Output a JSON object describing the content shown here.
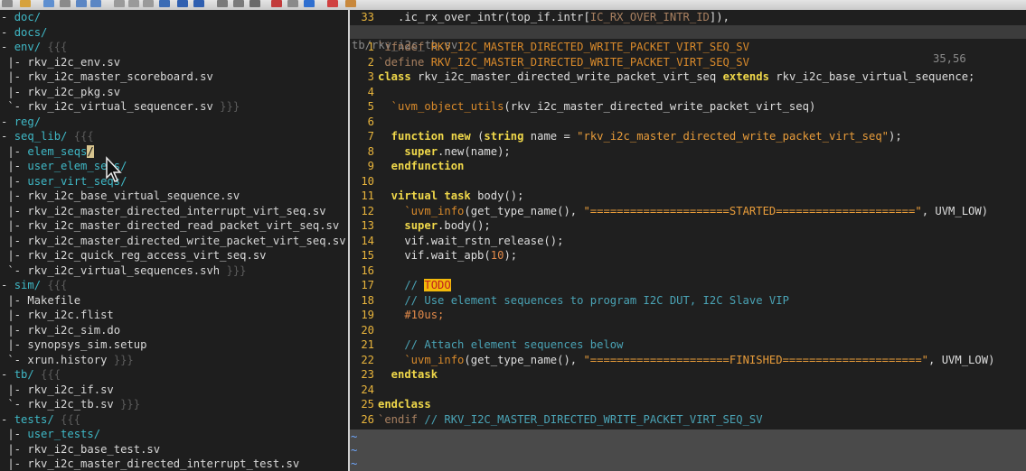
{
  "toolbar": {
    "icons": [
      "new-file-icon",
      "open-icon",
      "save-icon",
      "print-icon",
      "undo-icon",
      "redo-icon",
      "cut-icon",
      "copy-icon",
      "paste-icon",
      "find-icon",
      "back-icon",
      "forward-icon",
      "load-session-icon",
      "save-session-icon",
      "run-icon",
      "make-icon",
      "shell-icon",
      "tag-icon",
      "help-icon",
      "script-icon"
    ]
  },
  "file_tree": [
    {
      "text": "- doc/",
      "kind": "dir"
    },
    {
      "text": "- docs/",
      "kind": "dir"
    },
    {
      "text": "- env/",
      "kind": "dir",
      "fold": " {{{"
    },
    {
      "text": " |- rkv_i2c_env.sv",
      "kind": "file"
    },
    {
      "text": " |- rkv_i2c_master_scoreboard.sv",
      "kind": "file"
    },
    {
      "text": " |- rkv_i2c_pkg.sv",
      "kind": "file"
    },
    {
      "text": " `- rkv_i2c_virtual_sequencer.sv",
      "kind": "file",
      "fold": " }}}"
    },
    {
      "text": "- reg/",
      "kind": "dir"
    },
    {
      "text": "- seq_lib/",
      "kind": "dir",
      "fold": " {{{"
    },
    {
      "text": " |- elem_seqs",
      "kind": "dir",
      "sel": "/"
    },
    {
      "text": " |- user_elem_seqs/",
      "kind": "dir"
    },
    {
      "text": " |- user_virt_seqs/",
      "kind": "dir"
    },
    {
      "text": " |- rkv_i2c_base_virtual_sequence.sv",
      "kind": "file"
    },
    {
      "text": " |- rkv_i2c_master_directed_interrupt_virt_seq.sv",
      "kind": "file"
    },
    {
      "text": " |- rkv_i2c_master_directed_read_packet_virt_seq.sv",
      "kind": "file"
    },
    {
      "text": " |- rkv_i2c_master_directed_write_packet_virt_seq.sv",
      "kind": "file"
    },
    {
      "text": " |- rkv_i2c_quick_reg_access_virt_seq.sv",
      "kind": "file"
    },
    {
      "text": " `- rkv_i2c_virtual_sequences.svh",
      "kind": "file",
      "fold": " }}}"
    },
    {
      "text": "- sim/",
      "kind": "dir",
      "fold": " {{{"
    },
    {
      "text": " |- Makefile",
      "kind": "file"
    },
    {
      "text": " |- rkv_i2c.flist",
      "kind": "file"
    },
    {
      "text": " |- rkv_i2c_sim.do",
      "kind": "file"
    },
    {
      "text": " |- synopsys_sim.setup",
      "kind": "file"
    },
    {
      "text": " `- xrun.history",
      "kind": "file",
      "fold": " }}}"
    },
    {
      "text": "- tb/",
      "kind": "dir",
      "fold": " {{{"
    },
    {
      "text": " |- rkv_i2c_if.sv",
      "kind": "file"
    },
    {
      "text": " `- rkv_i2c_tb.sv",
      "kind": "file",
      "fold": " }}}"
    },
    {
      "text": "- tests/",
      "kind": "dir",
      "fold": " {{{"
    },
    {
      "text": " |- user_tests/",
      "kind": "dir"
    },
    {
      "text": " |- rkv_i2c_base_test.sv",
      "kind": "file"
    },
    {
      "text": " |- rkv_i2c_master_directed_interrupt_test.sv",
      "kind": "file"
    }
  ],
  "editor": {
    "top_line": [
      {
        "t": "33",
        "c": "ln"
      },
      {
        "t": "   .ic_rx_over_intr(top_if.intr[",
        "c": "id"
      },
      {
        "t": "IC_RX_OVER_INTR_ID",
        "c": "pp"
      },
      {
        "t": "]),",
        "c": "id"
      }
    ],
    "status_file": "tb/rkv_i2c_tb.sv",
    "status_pos": "35,56",
    "lines": [
      [
        {
          "t": "1",
          "c": "ln"
        },
        {
          "t": "`ifndef ",
          "c": "pp"
        },
        {
          "t": "RKV_I2C_MASTER_DIRECTED_WRITE_PACKET_VIRT_SEQ_SV",
          "c": "mac"
        }
      ],
      [
        {
          "t": "2",
          "c": "ln"
        },
        {
          "t": "`define ",
          "c": "pp"
        },
        {
          "t": "RKV_I2C_MASTER_DIRECTED_WRITE_PACKET_VIRT_SEQ_SV",
          "c": "mac"
        }
      ],
      [
        {
          "t": "3",
          "c": "ln"
        },
        {
          "t": "class",
          "c": "kw"
        },
        {
          "t": " rkv_i2c_master_directed_write_packet_virt_seq ",
          "c": "id"
        },
        {
          "t": "extends",
          "c": "kw"
        },
        {
          "t": " rkv_i2c_base_virtual_sequence;",
          "c": "id"
        }
      ],
      [
        {
          "t": "4",
          "c": "ln"
        }
      ],
      [
        {
          "t": "5",
          "c": "ln"
        },
        {
          "t": "  `uvm_object_utils",
          "c": "mac"
        },
        {
          "t": "(rkv_i2c_master_directed_write_packet_virt_seq)",
          "c": "id"
        }
      ],
      [
        {
          "t": "6",
          "c": "ln"
        }
      ],
      [
        {
          "t": "7",
          "c": "ln"
        },
        {
          "t": "  function",
          "c": "kw"
        },
        {
          "t": " ",
          "c": "id"
        },
        {
          "t": "new",
          "c": "kw"
        },
        {
          "t": " (",
          "c": "id"
        },
        {
          "t": "string",
          "c": "kw"
        },
        {
          "t": " name = ",
          "c": "id"
        },
        {
          "t": "\"rkv_i2c_master_directed_write_packet_virt_seq\"",
          "c": "str"
        },
        {
          "t": ");",
          "c": "id"
        }
      ],
      [
        {
          "t": "8",
          "c": "ln"
        },
        {
          "t": "    ",
          "c": "id"
        },
        {
          "t": "super",
          "c": "kw"
        },
        {
          "t": ".new(name);",
          "c": "id"
        }
      ],
      [
        {
          "t": "9",
          "c": "ln"
        },
        {
          "t": "  endfunction",
          "c": "kw"
        }
      ],
      [
        {
          "t": "10",
          "c": "ln"
        }
      ],
      [
        {
          "t": "11",
          "c": "ln"
        },
        {
          "t": "  virtual",
          "c": "kw"
        },
        {
          "t": " ",
          "c": "id"
        },
        {
          "t": "task",
          "c": "kw"
        },
        {
          "t": " body();",
          "c": "id"
        }
      ],
      [
        {
          "t": "12",
          "c": "ln"
        },
        {
          "t": "    `uvm_info",
          "c": "mac"
        },
        {
          "t": "(get_type_name(), ",
          "c": "id"
        },
        {
          "t": "\"=====================STARTED=====================\"",
          "c": "str"
        },
        {
          "t": ", UVM_LOW)",
          "c": "id"
        }
      ],
      [
        {
          "t": "13",
          "c": "ln"
        },
        {
          "t": "    ",
          "c": "id"
        },
        {
          "t": "super",
          "c": "kw"
        },
        {
          "t": ".body();",
          "c": "id"
        }
      ],
      [
        {
          "t": "14",
          "c": "ln"
        },
        {
          "t": "    vif.wait_rstn_release();",
          "c": "id"
        }
      ],
      [
        {
          "t": "15",
          "c": "ln"
        },
        {
          "t": "    vif.wait_apb(",
          "c": "id"
        },
        {
          "t": "10",
          "c": "num"
        },
        {
          "t": ");",
          "c": "id"
        }
      ],
      [
        {
          "t": "16",
          "c": "ln"
        }
      ],
      [
        {
          "t": "17",
          "c": "ln"
        },
        {
          "t": "    // ",
          "c": "cm"
        },
        {
          "t": "TODO",
          "c": "todo"
        }
      ],
      [
        {
          "t": "18",
          "c": "ln"
        },
        {
          "t": "    // Use element sequences to program I2C DUT, I2C Slave VIP",
          "c": "cm"
        }
      ],
      [
        {
          "t": "19",
          "c": "ln"
        },
        {
          "t": "    #10us;",
          "c": "num"
        }
      ],
      [
        {
          "t": "20",
          "c": "ln"
        }
      ],
      [
        {
          "t": "21",
          "c": "ln"
        },
        {
          "t": "    // Attach element sequences below",
          "c": "cm"
        }
      ],
      [
        {
          "t": "22",
          "c": "ln"
        },
        {
          "t": "    `uvm_info",
          "c": "mac"
        },
        {
          "t": "(get_type_name(), ",
          "c": "id"
        },
        {
          "t": "\"=====================FINISHED=====================\"",
          "c": "str"
        },
        {
          "t": ", UVM_LOW)",
          "c": "id"
        }
      ],
      [
        {
          "t": "23",
          "c": "ln"
        },
        {
          "t": "  endtask",
          "c": "kw"
        }
      ],
      [
        {
          "t": "24",
          "c": "ln"
        }
      ],
      [
        {
          "t": "25",
          "c": "ln"
        },
        {
          "t": "endclass",
          "c": "kw"
        }
      ],
      [
        {
          "t": "26",
          "c": "ln"
        },
        {
          "t": "`endif ",
          "c": "pp"
        },
        {
          "t": "// RKV_I2C_MASTER_DIRECTED_WRITE_PACKET_VIRT_SEQ_SV",
          "c": "cm"
        }
      ]
    ],
    "tildes": [
      "~",
      "~",
      "~"
    ]
  }
}
